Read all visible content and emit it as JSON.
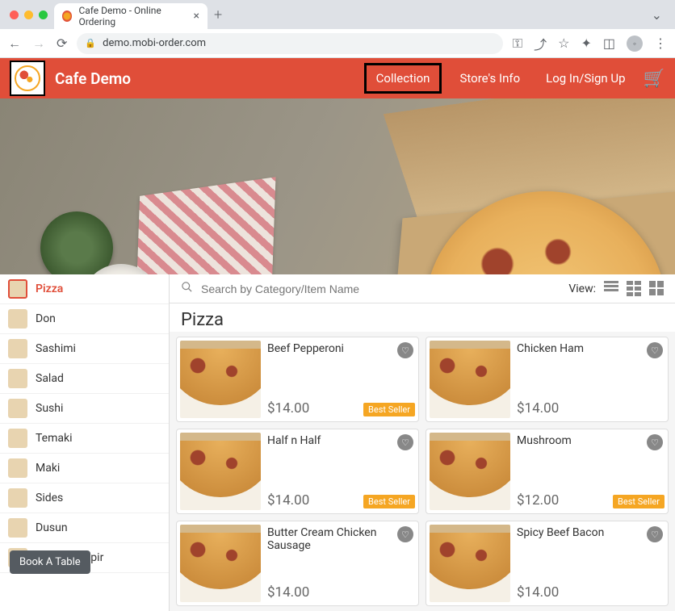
{
  "browser": {
    "tab_title": "Cafe Demo - Online Ordering",
    "url": "demo.mobi-order.com"
  },
  "header": {
    "site_name": "Cafe Demo",
    "links": {
      "collection": "Collection",
      "stores_info": "Store's Info",
      "login": "Log In/Sign Up"
    }
  },
  "search": {
    "placeholder": "Search by Category/Item Name",
    "view_label": "View:"
  },
  "categories": [
    {
      "label": "Pizza",
      "active": true
    },
    {
      "label": "Don"
    },
    {
      "label": "Sashimi"
    },
    {
      "label": "Salad"
    },
    {
      "label": "Sushi"
    },
    {
      "label": "Temaki"
    },
    {
      "label": "Maki"
    },
    {
      "label": "Sides"
    },
    {
      "label": "Dusun"
    },
    {
      "label": "Tapping Tapir"
    }
  ],
  "section": {
    "title": "Pizza"
  },
  "products": [
    {
      "name": "Beef Pepperoni",
      "price": "$14.00",
      "badge": "Best Seller"
    },
    {
      "name": "Chicken Ham",
      "price": "$14.00"
    },
    {
      "name": "Half n Half",
      "price": "$14.00",
      "badge": "Best Seller"
    },
    {
      "name": "Mushroom",
      "price": "$12.00",
      "badge": "Best Seller"
    },
    {
      "name": "Butter Cream Chicken Sausage",
      "price": "$14.00"
    },
    {
      "name": "Spicy Beef Bacon",
      "price": "$14.00"
    }
  ],
  "floating": {
    "book_table": "Book A Table"
  }
}
